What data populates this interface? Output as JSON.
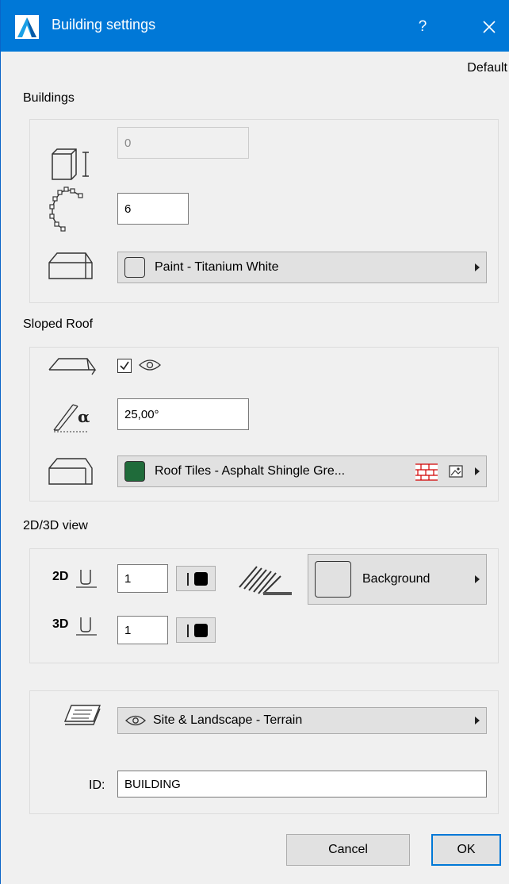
{
  "window": {
    "title": "Building settings",
    "help_label": "?",
    "default_label": "Default"
  },
  "buildings": {
    "section_title": "Buildings",
    "height_value": "0",
    "segments_value": "6",
    "surface_label": "Paint - Titanium White",
    "surface_color": "#ffffff"
  },
  "sloped_roof": {
    "section_title": "Sloped Roof",
    "checked": true,
    "angle_value": "25,00°",
    "surface_label": "Roof Tiles - Asphalt Shingle Gre...",
    "surface_color": "#1f6b3a"
  },
  "view": {
    "section_title": "2D/3D view",
    "label_2d": "2D",
    "label_3d": "3D",
    "pen_2d_value": "1",
    "pen_3d_value": "1",
    "background_label": "Background",
    "background_color": "#ffffff"
  },
  "layer": {
    "layer_label": "Site & Landscape - Terrain",
    "id_label": "ID:",
    "id_value": "BUILDING"
  },
  "buttons": {
    "cancel": "Cancel",
    "ok": "OK"
  },
  "colors": {
    "accent": "#0078d7",
    "panel": "#f0f0f0"
  }
}
